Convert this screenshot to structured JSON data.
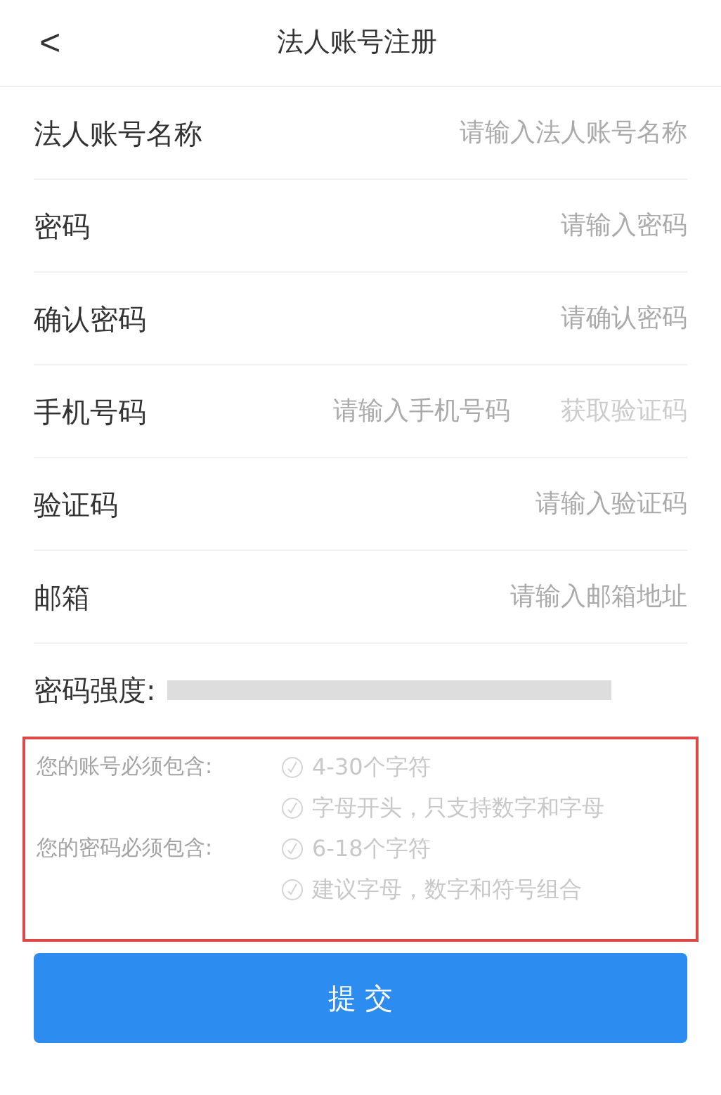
{
  "header": {
    "back": "<",
    "title": "法人账号注册"
  },
  "fields": [
    {
      "label": "法人账号名称",
      "placeholder": "请输入法人账号名称"
    },
    {
      "label": "密码",
      "placeholder": "请输入密码"
    },
    {
      "label": "确认密码",
      "placeholder": "请确认密码"
    },
    {
      "label": "手机号码",
      "placeholder": "请输入手机号码",
      "action": {
        "label": "获取验证码",
        "disabled": true
      }
    },
    {
      "label": "验证码",
      "placeholder": "请输入验证码"
    },
    {
      "label": "邮箱",
      "placeholder": "请输入邮箱地址"
    }
  ],
  "strength": {
    "label": "密码强度:",
    "level": 0
  },
  "requirements": [
    {
      "title": "您的账号必须包含:",
      "rules": [
        {
          "text": "4-30个字符",
          "met": false
        },
        {
          "text": "字母开头，只支持数字和字母",
          "met": false
        }
      ]
    },
    {
      "title": "您的密码必须包含:",
      "rules": [
        {
          "text": "6-18个字符",
          "met": false
        },
        {
          "text": "建议字母，数字和符号组合",
          "met": false
        }
      ]
    }
  ],
  "submit": "提 交"
}
